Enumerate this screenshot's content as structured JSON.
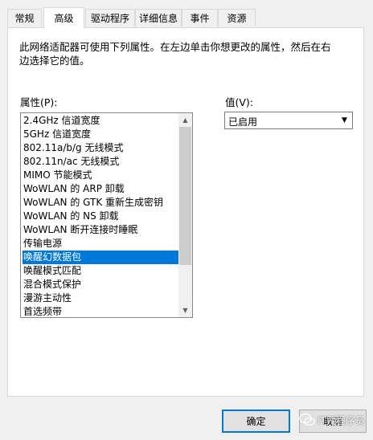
{
  "tabs": [
    {
      "label": "常规"
    },
    {
      "label": "高级"
    },
    {
      "label": "驱动程序"
    },
    {
      "label": "详细信息"
    },
    {
      "label": "事件"
    },
    {
      "label": "资源"
    }
  ],
  "description": "此网络适配器可使用下列属性。在左边单击你想更改的属性，然后在右边选择它的值。",
  "property_label": "属性(P):",
  "value_label": "值(V):",
  "properties": [
    {
      "label": "2.4GHz 信道宽度"
    },
    {
      "label": "5GHz 信道宽度"
    },
    {
      "label": "802.11a/b/g 无线模式"
    },
    {
      "label": "802.11n/ac 无线模式"
    },
    {
      "label": "MIMO 节能模式"
    },
    {
      "label": "WoWLAN 的 ARP 卸载"
    },
    {
      "label": "WoWLAN 的 GTK 重新生成密钥"
    },
    {
      "label": "WoWLAN 的 NS 卸载"
    },
    {
      "label": "WoWLAN 断开连接时睡眠"
    },
    {
      "label": "传输电源"
    },
    {
      "label": "唤醒幻数据包"
    },
    {
      "label": "唤醒模式匹配"
    },
    {
      "label": "混合模式保护"
    },
    {
      "label": "漫游主动性"
    },
    {
      "label": "首选频带"
    }
  ],
  "selected_property": "唤醒幻数据包",
  "value_select": {
    "value": "已启用"
  },
  "buttons": {
    "ok": "确定",
    "cancel": "取消"
  },
  "watermark": {
    "text": "IT咒程序员"
  },
  "colors": {
    "selection": "#0078d7",
    "accent_border": "#0078d7"
  }
}
